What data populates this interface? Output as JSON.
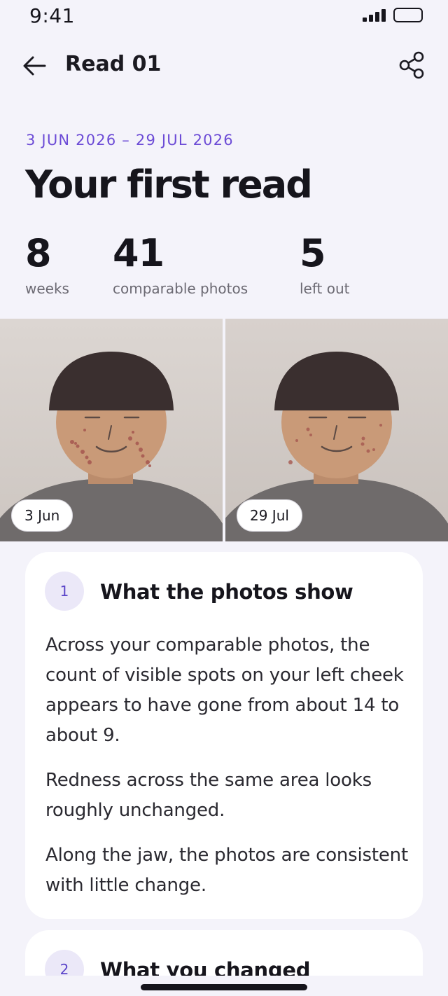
{
  "status_bar": {
    "time": "9:41"
  },
  "header": {
    "title": "Read 01",
    "back_icon": "arrow-left-icon",
    "share_icon": "share-icon"
  },
  "summary": {
    "date_range": "3 JUN 2026 – 29 JUL 2026",
    "title": "Your first read",
    "stats": [
      {
        "value": "8",
        "label": "weeks"
      },
      {
        "value": "41",
        "label": "comparable photos"
      },
      {
        "value": "5",
        "label": "left out"
      }
    ]
  },
  "photos": [
    {
      "label": "3 Jun"
    },
    {
      "label": "29 Jul"
    }
  ],
  "cards": [
    {
      "step": "1",
      "title": "What the photos show",
      "paragraphs": [
        "Across your comparable photos, the count of visible spots on your left cheek appears to have gone from about 14 to about 9.",
        "Redness across the same area looks roughly unchanged.",
        "Along the jaw, the photos are consistent with little change."
      ]
    },
    {
      "step": "2",
      "title": "What you changed"
    }
  ],
  "colors": {
    "accent": "#6c4bd6",
    "background": "#f4f3fa",
    "card": "#ffffff",
    "badge_bg": "#ebe8f8"
  }
}
